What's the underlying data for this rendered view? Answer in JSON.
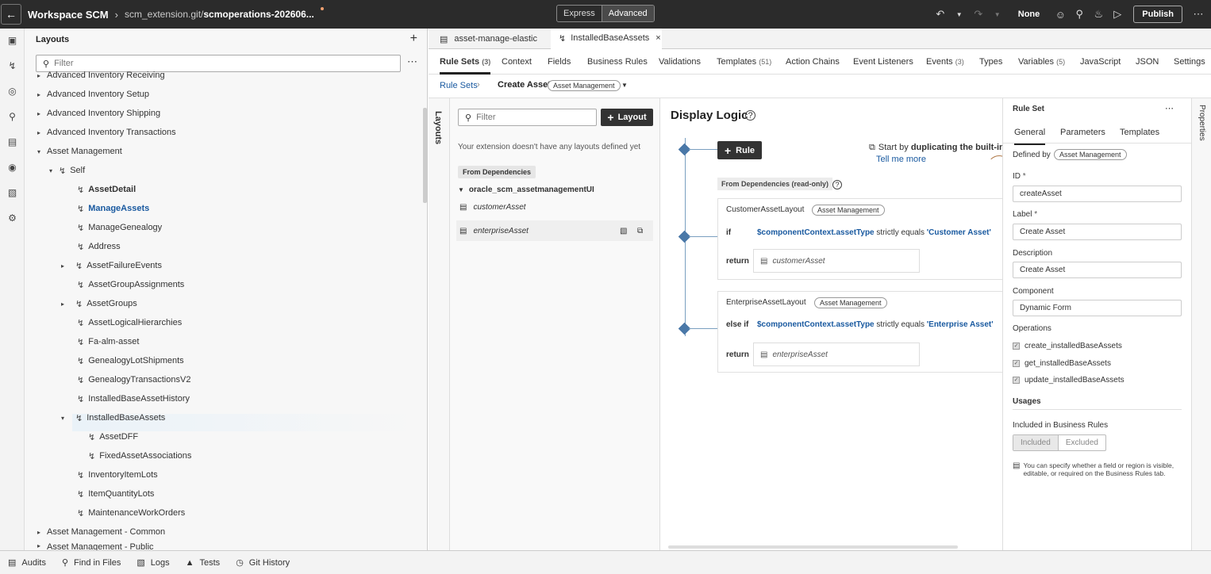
{
  "header": {
    "app_title": "Workspace SCM",
    "path": "scm_extension.git/",
    "file": "scmoperations-202606...",
    "modes": [
      "Express",
      "Advanced"
    ],
    "active_mode": "Advanced",
    "preview_label": "None",
    "publish_label": "Publish"
  },
  "layouts_panel": {
    "title": "Layouts",
    "filter_placeholder": "Filter",
    "items": [
      "Advanced Inventory Receiving",
      "Advanced Inventory Setup",
      "Advanced Inventory Shipping",
      "Advanced Inventory Transactions",
      "Asset Management",
      "Self",
      "AssetDetail",
      "ManageAssets",
      "ManageGenealogy",
      "Address",
      "AssetFailureEvents",
      "AssetGroupAssignments",
      "AssetGroups",
      "AssetLogicalHierarchies",
      "Fa-alm-asset",
      "GenealogyLotShipments",
      "GenealogyTransactionsV2",
      "InstalledBaseAssetHistory",
      "InstalledBaseAssets",
      "AssetDFF",
      "FixedAssetAssociations",
      "InventoryItemLots",
      "ItemQuantityLots",
      "MaintenanceWorkOrders",
      "Asset Management - Common",
      "Asset Management - Public"
    ]
  },
  "editor_tabs": [
    "asset-manage-elastic",
    "InstalledBaseAssets"
  ],
  "subnav": [
    {
      "label": "Rule Sets",
      "count": "(3)"
    },
    {
      "label": "Context",
      "count": ""
    },
    {
      "label": "Fields",
      "count": ""
    },
    {
      "label": "Business Rules",
      "count": ""
    },
    {
      "label": "Validations",
      "count": ""
    },
    {
      "label": "Templates",
      "count": "(51)"
    },
    {
      "label": "Action Chains",
      "count": ""
    },
    {
      "label": "Event Listeners",
      "count": ""
    },
    {
      "label": "Events",
      "count": "(3)"
    },
    {
      "label": "Types",
      "count": ""
    },
    {
      "label": "Variables",
      "count": "(5)"
    },
    {
      "label": "JavaScript",
      "count": ""
    },
    {
      "label": "JSON",
      "count": ""
    },
    {
      "label": "Settings",
      "count": ""
    }
  ],
  "breadcrumb": {
    "root": "Rule Sets",
    "current": "Create Asset",
    "badge": "Asset Management"
  },
  "layouts_col": {
    "vertical_label": "Layouts",
    "filter_placeholder": "Filter",
    "layout_button": "Layout",
    "empty_msg": "Your extension doesn't have any layouts defined yet",
    "dep_header": "From Dependencies",
    "group": "oracle_scm_assetmanagementUI",
    "items": [
      "customerAsset",
      "enterpriseAsset"
    ]
  },
  "logic": {
    "title": "Display Logic",
    "rule_button": "Rule",
    "hint_prefix": "Start by ",
    "hint_bold": "duplicating the built-in",
    "hint_link": "Tell me more",
    "dep_label": "From Dependencies (read-only)",
    "cards": [
      {
        "name": "CustomerAssetLayout",
        "badge": "Asset Management",
        "keyword": "if",
        "var": "$componentContext.assetType",
        "op": "strictly equals",
        "value": "'Customer Asset'",
        "return_label": "return",
        "return_value": "customerAsset"
      },
      {
        "name": "EnterpriseAssetLayout",
        "badge": "Asset Management",
        "keyword": "else if",
        "var": "$componentContext.assetType",
        "op": "strictly equals",
        "value": "'Enterprise Asset'",
        "return_label": "return",
        "return_value": "enterpriseAsset"
      }
    ]
  },
  "props": {
    "title": "Rule Set",
    "tabs": [
      "General",
      "Parameters",
      "Templates"
    ],
    "defined_by_label": "Defined by",
    "defined_by": "Asset Management",
    "id_label": "ID",
    "id": "createAsset",
    "label_label": "Label",
    "label": "Create Asset",
    "desc_label": "Description",
    "desc": "Create Asset",
    "comp_label": "Component",
    "comp": "Dynamic Form",
    "ops_label": "Operations",
    "ops": [
      "create_installedBaseAssets",
      "get_installedBaseAssets",
      "update_installedBaseAssets"
    ],
    "usages_label": "Usages",
    "included_label": "Included in Business Rules",
    "included": "Included",
    "excluded": "Excluded",
    "note": "You can specify whether a field or region is visible, editable, or required on the Business Rules tab.",
    "rail_label": "Properties"
  },
  "status_bar": [
    "Audits",
    "Find in Files",
    "Logs",
    "Tests",
    "Git History"
  ]
}
